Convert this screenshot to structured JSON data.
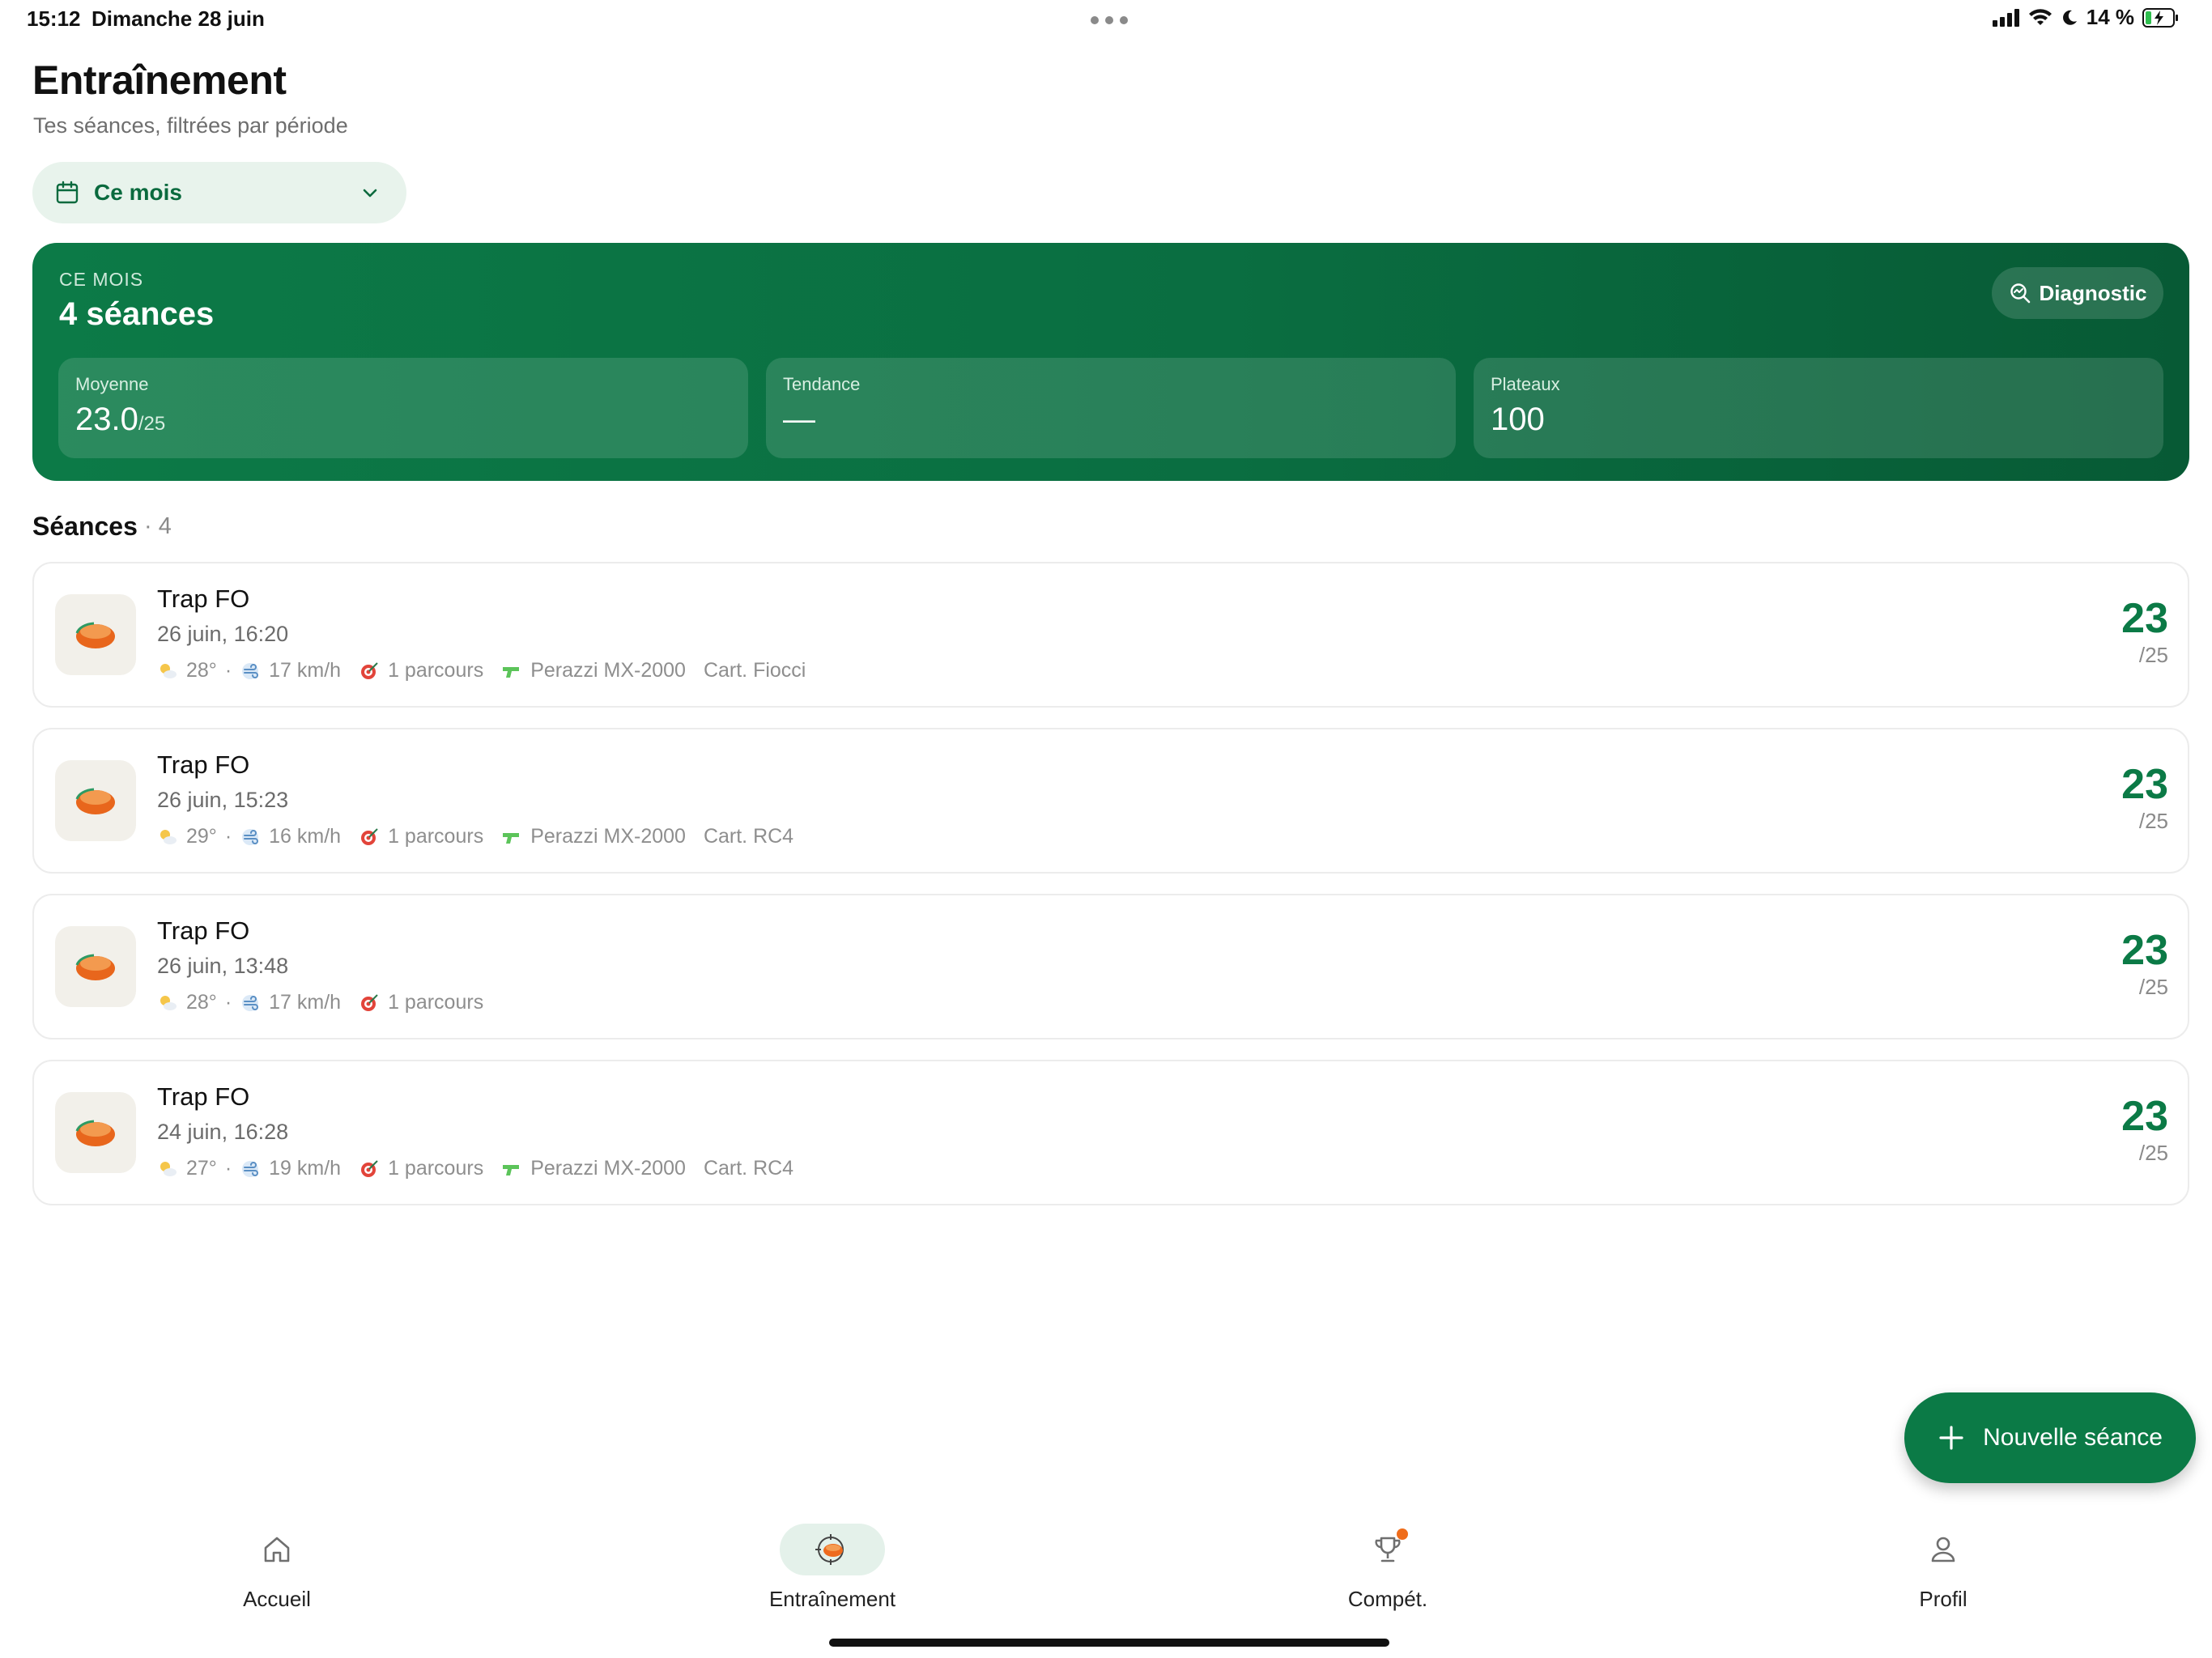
{
  "status_bar": {
    "time": "15:12",
    "date": "Dimanche 28 juin",
    "battery": "14 %"
  },
  "header": {
    "title": "Entraînement",
    "subtitle": "Tes séances, filtrées par période"
  },
  "period": {
    "selected": "Ce mois"
  },
  "summary": {
    "eyebrow": "CE MOIS",
    "count": "4 séances",
    "diagnostic_label": "Diagnostic",
    "stats": [
      {
        "label": "Moyenne",
        "value": "23.0",
        "suffix": "/25"
      },
      {
        "label": "Tendance",
        "value": "—",
        "suffix": ""
      },
      {
        "label": "Plateaux",
        "value": "100",
        "suffix": ""
      }
    ]
  },
  "sessions_section": {
    "title": "Séances",
    "count": "· 4"
  },
  "sessions": [
    {
      "title": "Trap FO",
      "date": "26 juin, 16:20",
      "temp": "28°",
      "sep": "·",
      "wind": "17 km/h",
      "courses": "1 parcours",
      "gun": "Perazzi MX-2000",
      "cart": "Cart. Fiocci",
      "score": "23",
      "max": "/25"
    },
    {
      "title": "Trap FO",
      "date": "26 juin, 15:23",
      "temp": "29°",
      "sep": "·",
      "wind": "16 km/h",
      "courses": "1 parcours",
      "gun": "Perazzi MX-2000",
      "cart": "Cart. RC4",
      "score": "23",
      "max": "/25"
    },
    {
      "title": "Trap FO",
      "date": "26 juin, 13:48",
      "temp": "28°",
      "sep": "·",
      "wind": "17 km/h",
      "courses": "1 parcours",
      "gun": "",
      "cart": "",
      "score": "23",
      "max": "/25"
    },
    {
      "title": "Trap FO",
      "date": "24 juin, 16:28",
      "temp": "27°",
      "sep": "·",
      "wind": "19 km/h",
      "courses": "1 parcours",
      "gun": "Perazzi MX-2000",
      "cart": "Cart. RC4",
      "score": "23",
      "max": "/25"
    }
  ],
  "fab": {
    "label": "Nouvelle séance"
  },
  "tabs": [
    {
      "label": "Accueil",
      "icon": "home-icon"
    },
    {
      "label": "Entraînement",
      "icon": "clay-target-icon"
    },
    {
      "label": "Compét.",
      "icon": "trophy-icon"
    },
    {
      "label": "Profil",
      "icon": "user-icon"
    }
  ],
  "colors": {
    "brand_green": "#0b7a46",
    "accent_orange": "#ef6c1a"
  }
}
